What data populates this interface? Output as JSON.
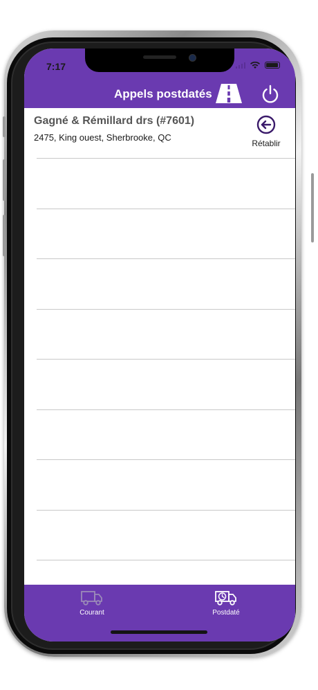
{
  "status_bar": {
    "time": "7:17"
  },
  "header": {
    "title": "Appels postdatés",
    "road_icon": "road-icon",
    "power_icon": "power-icon"
  },
  "list": {
    "items": [
      {
        "name": "Gagné & Rémillard drs (#7601)",
        "address": "2475, King ouest, Sherbrooke, QC",
        "action_label": "Rétablir",
        "action_icon": "arrow-left-circle-icon"
      }
    ]
  },
  "tabs": [
    {
      "label": "Courant",
      "icon": "truck-icon",
      "active": false
    },
    {
      "label": "Postdaté",
      "icon": "truck-clock-icon",
      "active": true
    }
  ],
  "colors": {
    "primary": "#6a3ab0",
    "tab_inactive_icon": "#9b8bb8",
    "tab_active_icon": "#ffffff"
  }
}
